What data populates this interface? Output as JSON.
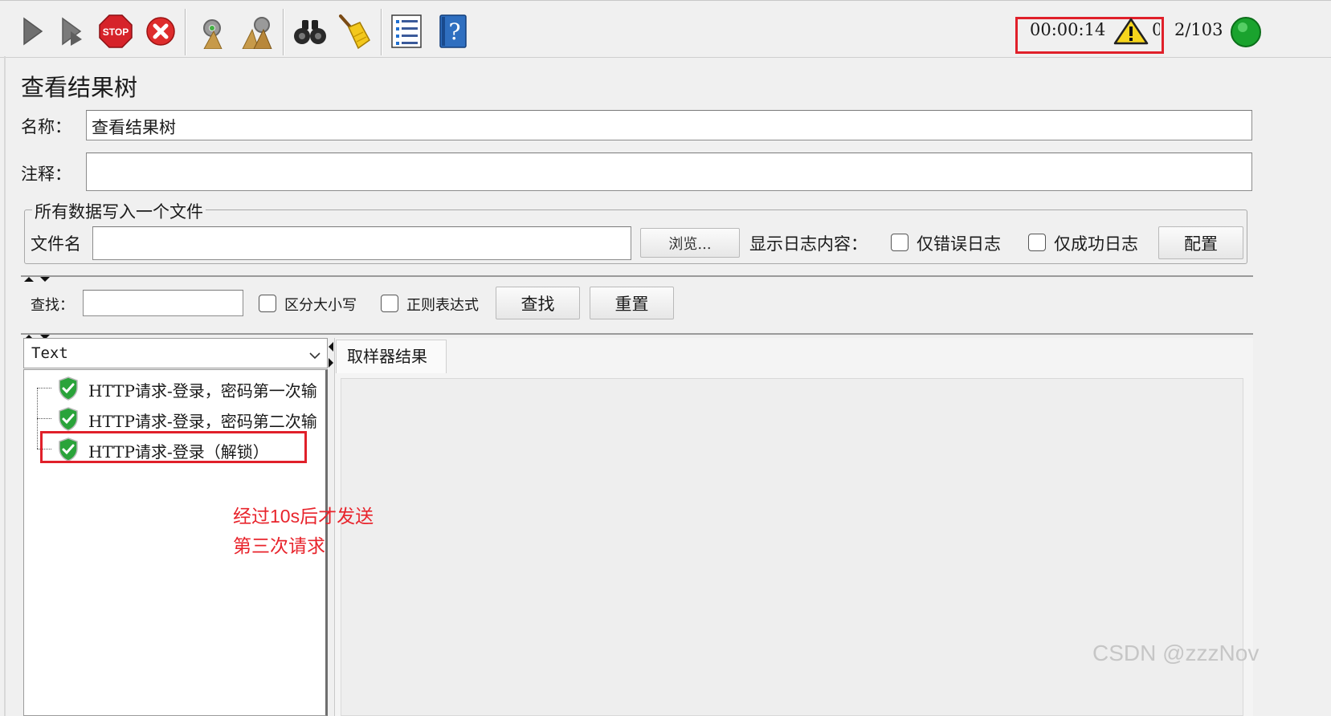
{
  "toolbar": {
    "icons": [
      "start-icon",
      "start-no-pause-icon",
      "stop-icon",
      "shutdown-icon",
      "clear-icon",
      "clear-all-icon",
      "search-binoculars-icon",
      "reset-search-broom-icon",
      "function-helper-icon",
      "help-icon"
    ],
    "elapsed": "00:00:14",
    "error_count": "0",
    "thread_count": "2/103"
  },
  "panel": {
    "title": "查看结果树",
    "name_label": "名称：",
    "name_value": "查看结果树",
    "comment_label": "注释：",
    "comment_value": ""
  },
  "file_group": {
    "legend": "所有数据写入一个文件",
    "filename_label": "文件名",
    "filename_value": "",
    "browse_label": "浏览...",
    "log_content_label": "显示日志内容：",
    "errors_only_label": "仅错误日志",
    "success_only_label": "仅成功日志",
    "config_label": "配置"
  },
  "search_bar": {
    "find_label": "查找：",
    "find_value": "",
    "case_label": "区分大小写",
    "regex_label": "正则表达式",
    "find_button": "查找",
    "reset_button": "重置"
  },
  "renderer": {
    "selected": "Text"
  },
  "results_tree": {
    "items": [
      {
        "label": "HTTP请求-登录，密码第一次输",
        "status": "success"
      },
      {
        "label": "HTTP请求-登录，密码第二次输",
        "status": "success"
      },
      {
        "label": "HTTP请求-登录（解锁）",
        "status": "success"
      }
    ]
  },
  "result_tabs": {
    "sampler_result": "取样器结果"
  },
  "annotation": {
    "line1": "经过10s后才发送",
    "line2": "第三次请求"
  },
  "watermark": "CSDN @zzzNov",
  "colors": {
    "highlight": "#e0202a",
    "annotation_text": "#e8242c",
    "success_green": "#2aa33a"
  }
}
